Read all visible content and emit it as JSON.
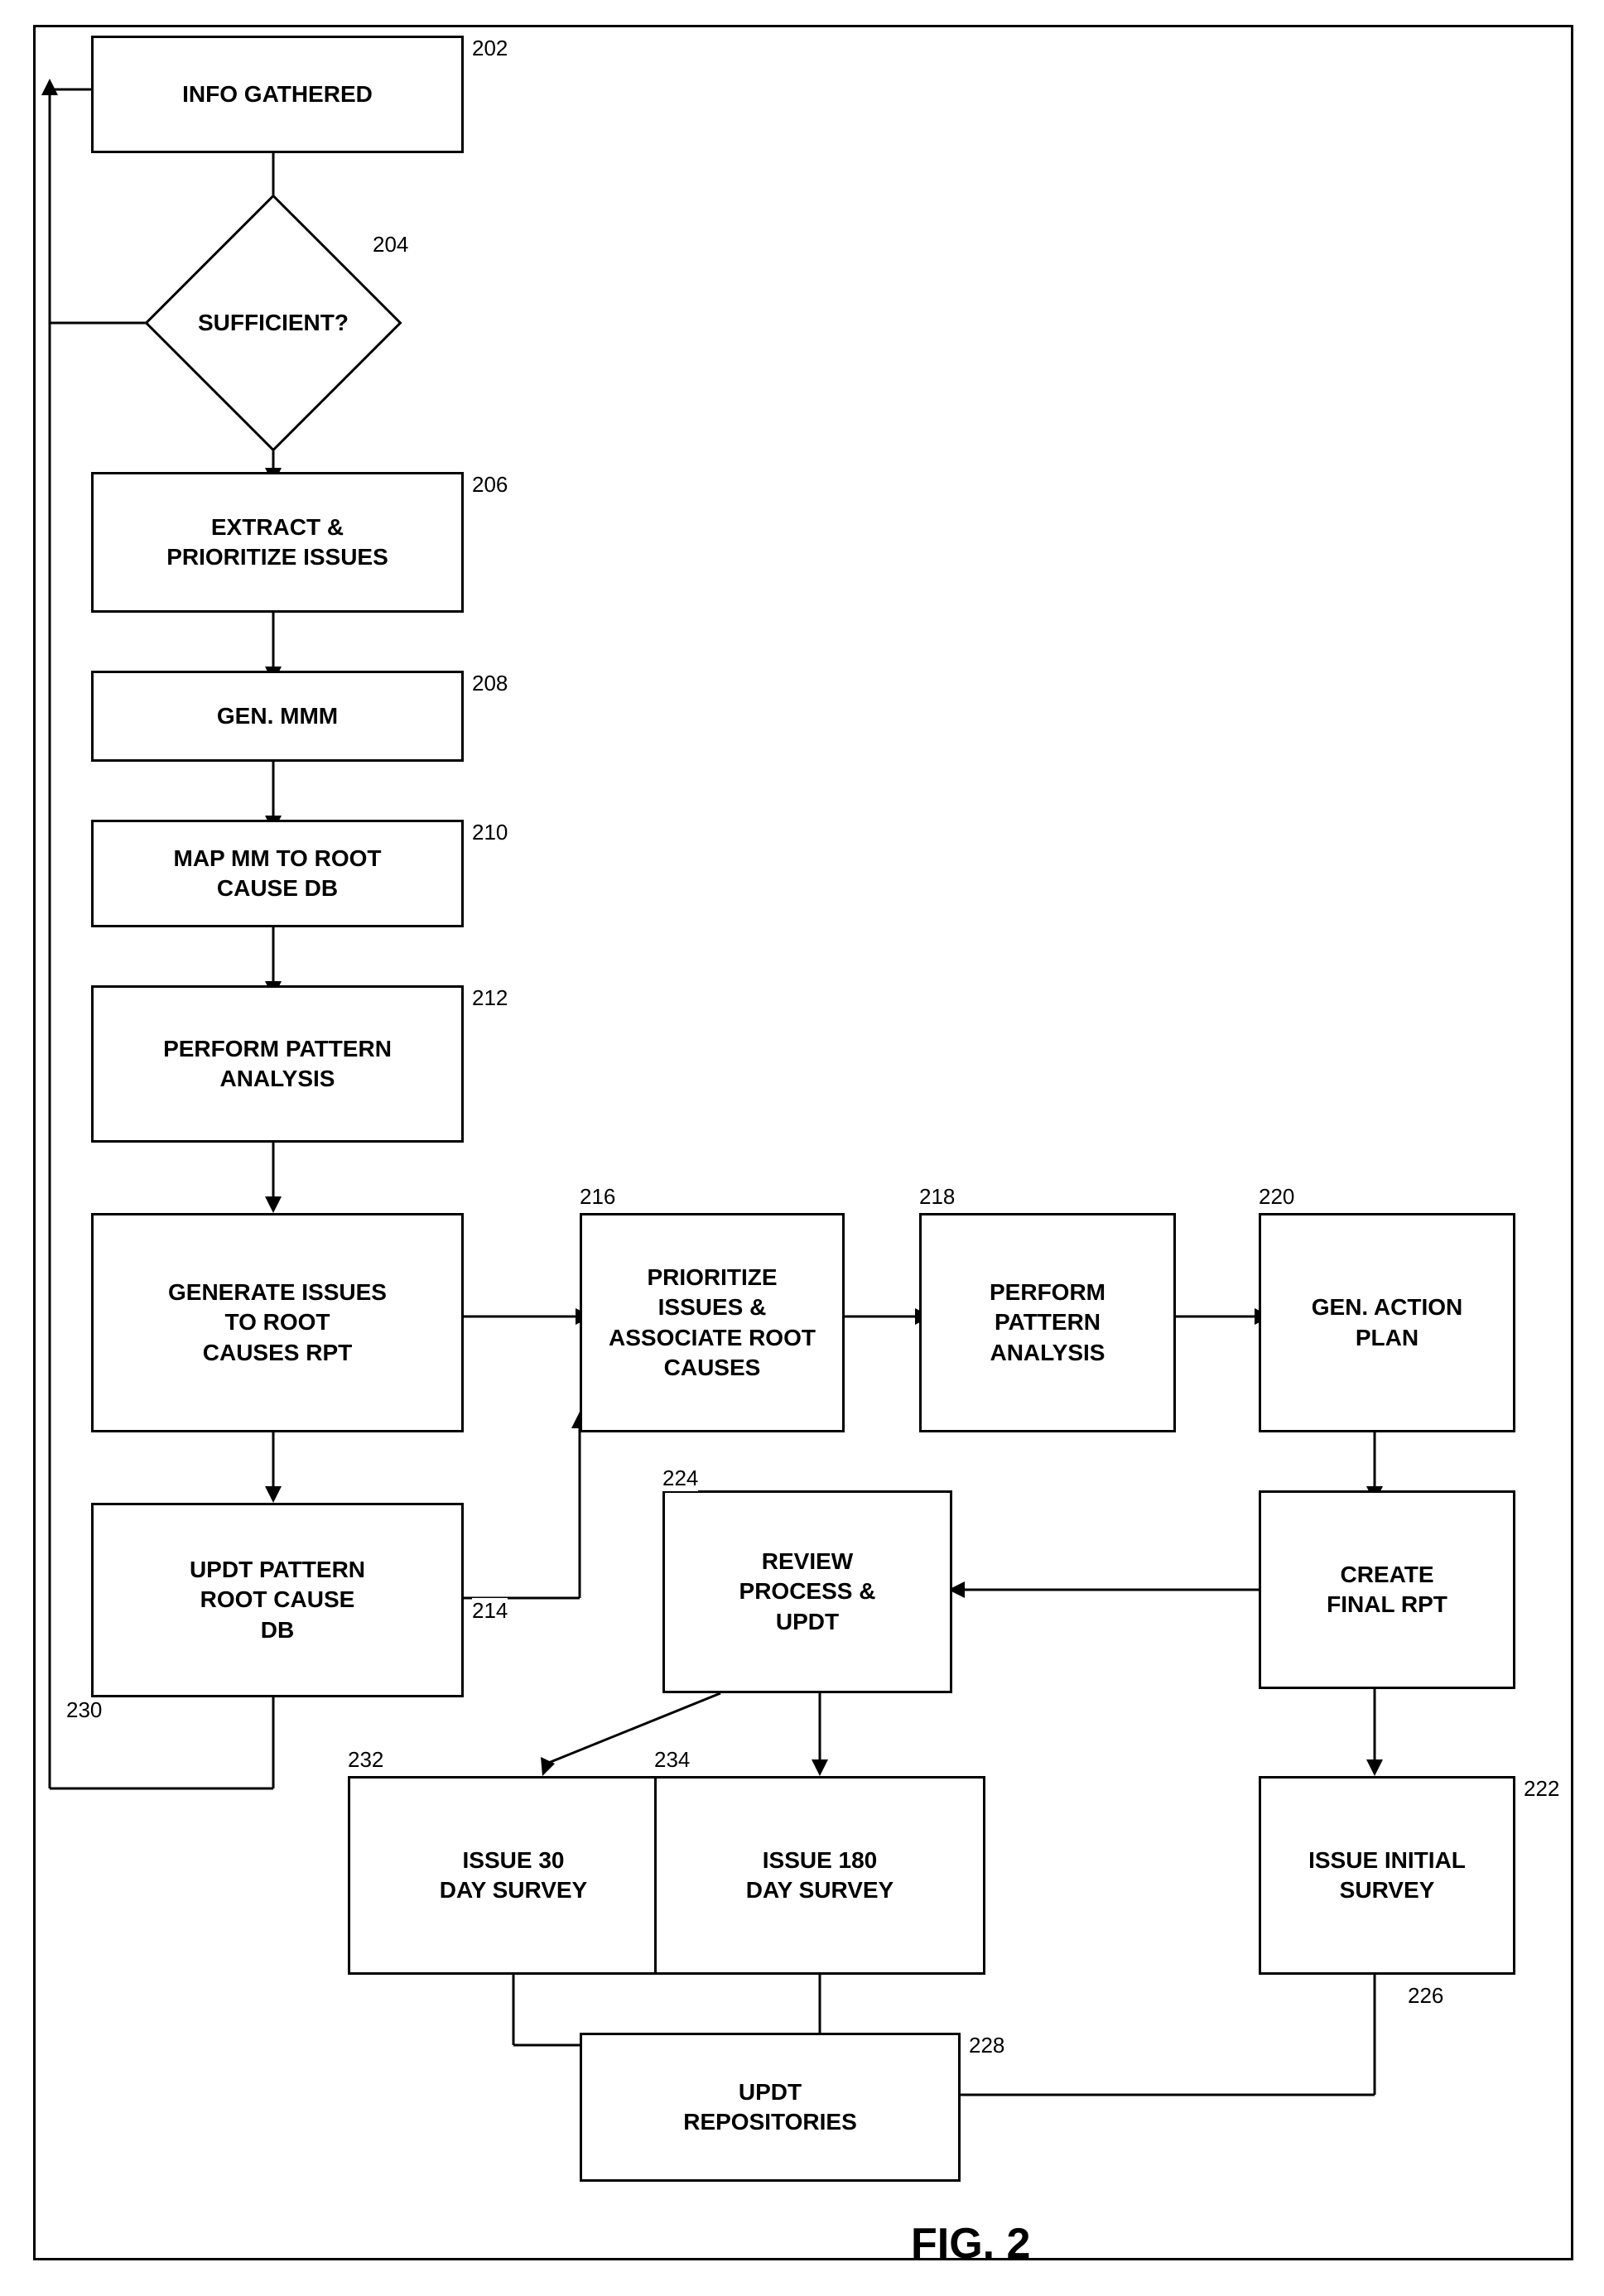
{
  "diagram": {
    "title": "FIG. 2",
    "nodes": {
      "info_gathered": {
        "label": "INFO GATHERED",
        "ref": "202"
      },
      "sufficient": {
        "label": "SUFFICIENT?",
        "ref": "204"
      },
      "extract_prioritize": {
        "label": "EXTRACT &\nPRIORITIZE ISSUES",
        "ref": "206"
      },
      "gen_mmm": {
        "label": "GEN. MMM",
        "ref": "208"
      },
      "map_mm": {
        "label": "MAP MM TO ROOT\nCAUSE DB",
        "ref": "210"
      },
      "perform_pattern": {
        "label": "PERFORM PATTERN\nANALYSIS",
        "ref": "212"
      },
      "generate_issues": {
        "label": "GENERATE ISSUES\nTO ROOT\nCAUSES RPT",
        "ref": ""
      },
      "updt_pattern": {
        "label": "UPDT PATTERN\nROOT CAUSE\nDB",
        "ref": "214"
      },
      "prioritize_issues": {
        "label": "PRIORITIZE\nISSUES &\nASSOCIATE ROOT\nCAUSES",
        "ref": "216"
      },
      "perform_pattern2": {
        "label": "PERFORM\nPATTERN\nANALYSIS",
        "ref": "218"
      },
      "gen_action_plan": {
        "label": "GEN. ACTION\nPLAN",
        "ref": "220"
      },
      "create_final_rpt": {
        "label": "CREATE\nFINAL RPT",
        "ref": ""
      },
      "review_process": {
        "label": "REVIEW\nPROCESS &\nUPDT",
        "ref": "224"
      },
      "issue_initial_survey": {
        "label": "ISSUE INITIAL\nSURVEY",
        "ref": "222"
      },
      "issue_30": {
        "label": "ISSUE 30\nDAY SURVEY",
        "ref": "232"
      },
      "issue_180": {
        "label": "ISSUE 180\nDAY SURVEY",
        "ref": "234"
      },
      "updt_repos": {
        "label": "UPDT\nREPOSITORIES",
        "ref": "228"
      }
    },
    "refs": {
      "230": "230",
      "226": "226"
    }
  }
}
